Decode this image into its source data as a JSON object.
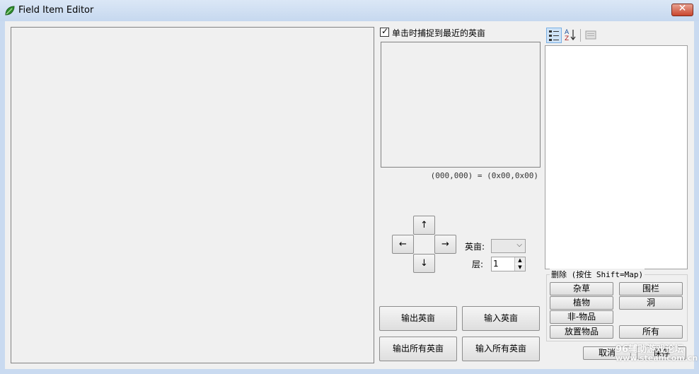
{
  "window": {
    "title": "Field Item Editor",
    "close_glyph": "✕",
    "icon": "leaf-icon"
  },
  "options": {
    "snap_checkbox_label": "单击时捕捉到最近的英亩",
    "snap_checked": true
  },
  "coords_text": "(000,000) = (0x00,0x00)",
  "nav": {
    "up": "↑",
    "down": "↓",
    "left": "←",
    "right": "→"
  },
  "acre": {
    "label": "英亩:",
    "value": ""
  },
  "layer": {
    "label": "层:",
    "value": "1"
  },
  "delete_group": {
    "title": "删除 (按住 Shift=Map)",
    "buttons": [
      "杂草",
      "围栏",
      "植物",
      "洞",
      "非-物品",
      "放置物品",
      "所有"
    ]
  },
  "io_buttons": {
    "export_acre": "输出英亩",
    "import_acre": "输入英亩",
    "export_all": "输出所有英亩",
    "import_all": "输入所有英亩"
  },
  "dialog_buttons": {
    "cancel": "取消",
    "save": "保存"
  },
  "watermark": {
    "line1": "96辅助游戏论坛",
    "line2": "www.steamcom.cn"
  },
  "colors": {
    "titlebar": "#c9daf0",
    "client_bg": "#f0f0f0",
    "close_button": "#c9452d"
  }
}
